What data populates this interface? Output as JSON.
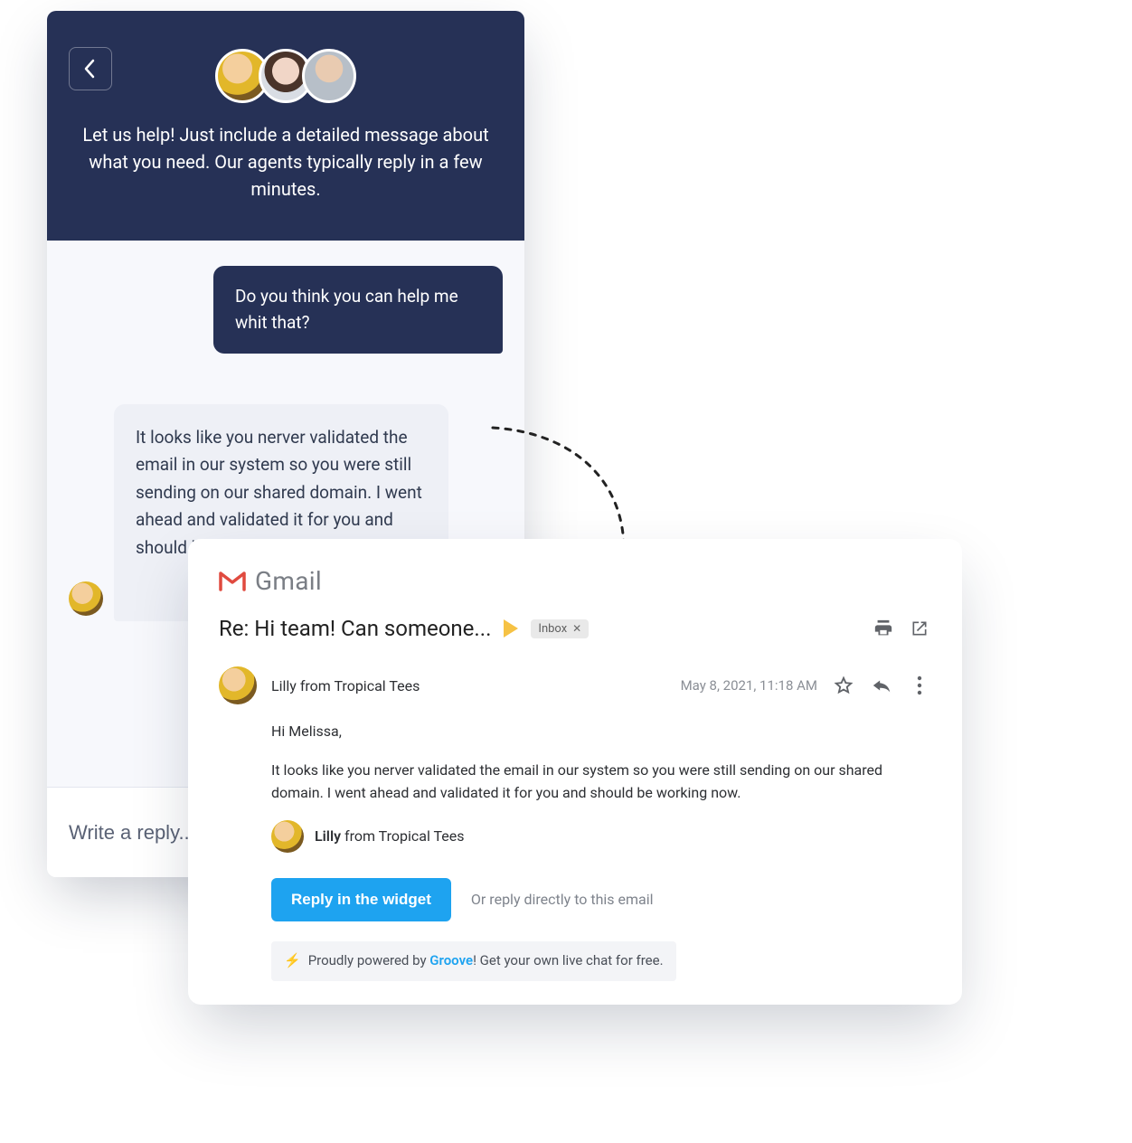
{
  "chat": {
    "header": {
      "intro": "Let us help! Just include a detailed message about what you need. Our agents typically reply in a few minutes."
    },
    "messages": {
      "user_1": "Do you think you can help me whit that?",
      "agent_1": "It looks like you nerver validated the email in our system so you were still sending on our shared domain. I went ahead and validated it for you and should be working now."
    },
    "footer": {
      "placeholder": "Write a reply..."
    }
  },
  "email": {
    "brand": "Gmail",
    "subject": "Re: Hi team! Can someone...",
    "inbox_tag": "Inbox",
    "from": "Lilly from Tropical Tees",
    "date": "May 8, 2021, 11:18 AM",
    "greeting": "Hi Melissa,",
    "body": "It looks like you nerver validated the email in our system so you were still sending on our shared domain. I went ahead and validated it for you and should be working now.",
    "signature_name": "Lilly",
    "signature_rest": " from Tropical Tees",
    "reply_button": "Reply in the widget",
    "or_reply": "Or reply directly to this email",
    "powered_pre": "Proudly powered by ",
    "powered_brand": "Groove",
    "powered_post": "! Get your own live chat for free."
  }
}
